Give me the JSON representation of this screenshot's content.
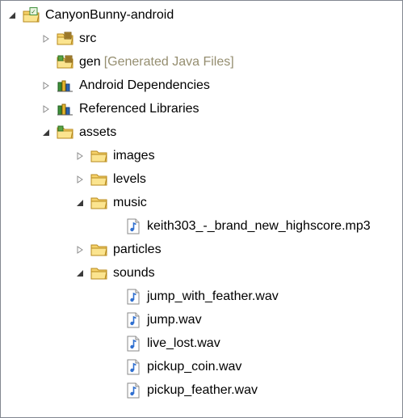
{
  "project_explorer": {
    "items": [
      {
        "label": "CanyonBunny-android",
        "decoration": "",
        "depth": 0,
        "toggle": "expanded",
        "icon": "android-project-icon"
      },
      {
        "label": "src",
        "decoration": "",
        "depth": 1,
        "toggle": "collapsed",
        "icon": "source-folder-icon"
      },
      {
        "label": "gen",
        "decoration": "[Generated Java Files]",
        "depth": 1,
        "toggle": "none",
        "icon": "generated-folder-icon"
      },
      {
        "label": "Android Dependencies",
        "decoration": "",
        "depth": 1,
        "toggle": "collapsed",
        "icon": "library-icon"
      },
      {
        "label": "Referenced Libraries",
        "decoration": "",
        "depth": 1,
        "toggle": "collapsed",
        "icon": "library-icon"
      },
      {
        "label": "assets",
        "decoration": "",
        "depth": 1,
        "toggle": "expanded",
        "icon": "assets-folder-icon"
      },
      {
        "label": "images",
        "decoration": "",
        "depth": 2,
        "toggle": "collapsed",
        "icon": "folder-icon"
      },
      {
        "label": "levels",
        "decoration": "",
        "depth": 2,
        "toggle": "collapsed",
        "icon": "folder-icon"
      },
      {
        "label": "music",
        "decoration": "",
        "depth": 2,
        "toggle": "expanded",
        "icon": "folder-icon"
      },
      {
        "label": "keith303_-_brand_new_highscore.mp3",
        "decoration": "",
        "depth": 3,
        "toggle": "none",
        "icon": "audio-file-icon"
      },
      {
        "label": "particles",
        "decoration": "",
        "depth": 2,
        "toggle": "collapsed",
        "icon": "folder-icon"
      },
      {
        "label": "sounds",
        "decoration": "",
        "depth": 2,
        "toggle": "expanded",
        "icon": "folder-icon"
      },
      {
        "label": "jump_with_feather.wav",
        "decoration": "",
        "depth": 3,
        "toggle": "none",
        "icon": "audio-file-icon"
      },
      {
        "label": "jump.wav",
        "decoration": "",
        "depth": 3,
        "toggle": "none",
        "icon": "audio-file-icon"
      },
      {
        "label": "live_lost.wav",
        "decoration": "",
        "depth": 3,
        "toggle": "none",
        "icon": "audio-file-icon"
      },
      {
        "label": "pickup_coin.wav",
        "decoration": "",
        "depth": 3,
        "toggle": "none",
        "icon": "audio-file-icon"
      },
      {
        "label": "pickup_feather.wav",
        "decoration": "",
        "depth": 3,
        "toggle": "none",
        "icon": "audio-file-icon"
      }
    ]
  }
}
